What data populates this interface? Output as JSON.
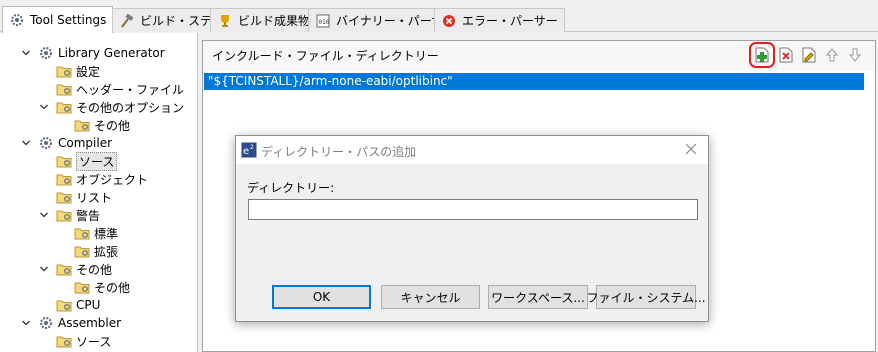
{
  "tabs": [
    {
      "label": "Tool Settings",
      "icon": "gear-icon",
      "active": true
    },
    {
      "label": "ビルド・ステップ",
      "icon": "hammer-icon"
    },
    {
      "label": "ビルド成果物",
      "icon": "trophy-icon"
    },
    {
      "label": "バイナリー・パーサー",
      "icon": "binary-icon"
    },
    {
      "label": "エラー・パーサー",
      "icon": "error-icon"
    }
  ],
  "tree": [
    {
      "label": "Library Generator",
      "type": "gear",
      "expanded": true
    },
    {
      "label": "設定",
      "type": "folder"
    },
    {
      "label": "ヘッダー・ファイル",
      "type": "folder"
    },
    {
      "label": "その他のオプション",
      "type": "folder",
      "expanded": true
    },
    {
      "label": "その他",
      "type": "folder"
    },
    {
      "label": "Compiler",
      "type": "gear",
      "expanded": true
    },
    {
      "label": "ソース",
      "type": "folder",
      "selected": true
    },
    {
      "label": "オブジェクト",
      "type": "folder"
    },
    {
      "label": "リスト",
      "type": "folder"
    },
    {
      "label": "警告",
      "type": "folder",
      "expanded": true
    },
    {
      "label": "標準",
      "type": "folder"
    },
    {
      "label": "拡張",
      "type": "folder"
    },
    {
      "label": "その他",
      "type": "folder",
      "expanded": true
    },
    {
      "label": "その他",
      "type": "folder"
    },
    {
      "label": "CPU",
      "type": "folder"
    },
    {
      "label": "Assembler",
      "type": "gear",
      "expanded": true
    },
    {
      "label": "ソース",
      "type": "folder"
    }
  ],
  "panel": {
    "title": "インクルード・ファイル・ディレクトリー",
    "tools": [
      "add-icon",
      "delete-icon",
      "edit-icon",
      "move-up-icon",
      "move-down-icon"
    ],
    "items": [
      "\"${TCINSTALL}/arm-none-eabi/optlibinc\""
    ]
  },
  "dialog": {
    "title": "ディレクトリー・パスの追加",
    "field_label": "ディレクトリー:",
    "field_value": "",
    "ok": "OK",
    "cancel": "キャンセル",
    "workspace": "ワークスペース...",
    "filesystem": "ファイル・システム..."
  },
  "colors": {
    "selection": "#0078d7",
    "highlight": "#e02020"
  }
}
